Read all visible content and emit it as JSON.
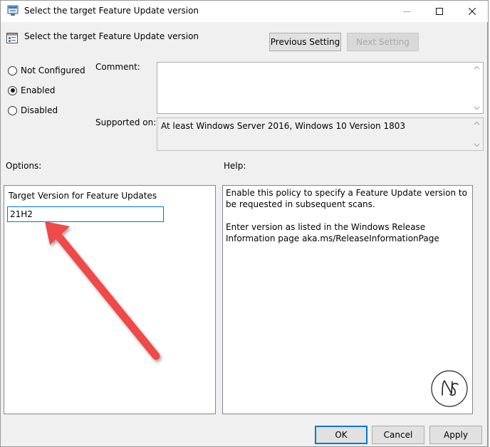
{
  "window": {
    "title": "Select the target Feature Update version"
  },
  "header": {
    "policy_title": "Select the target Feature Update version",
    "prev_label": "Previous Setting",
    "next_label": "Next Setting"
  },
  "state": {
    "options": [
      {
        "label": "Not Configured",
        "checked": false
      },
      {
        "label": "Enabled",
        "checked": true
      },
      {
        "label": "Disabled",
        "checked": false
      }
    ]
  },
  "comment": {
    "label": "Comment:",
    "value": ""
  },
  "supported": {
    "label": "Supported on:",
    "value": "At least Windows Server 2016, Windows 10 Version 1803"
  },
  "options_panel": {
    "heading": "Options:",
    "field_label": "Target Version for Feature Updates",
    "field_value": "21H2"
  },
  "help_panel": {
    "heading": "Help:",
    "paragraph1": "Enable this policy to specify a Feature Update version to be requested in subsequent scans.",
    "paragraph2": "Enter version as listed in the Windows Release Information page aka.ms/ReleaseInformationPage"
  },
  "footer": {
    "ok_label": "OK",
    "cancel_label": "Cancel",
    "apply_label": "Apply"
  },
  "colors": {
    "annotation_arrow": "#f04848",
    "focus_border": "#0078d7"
  }
}
